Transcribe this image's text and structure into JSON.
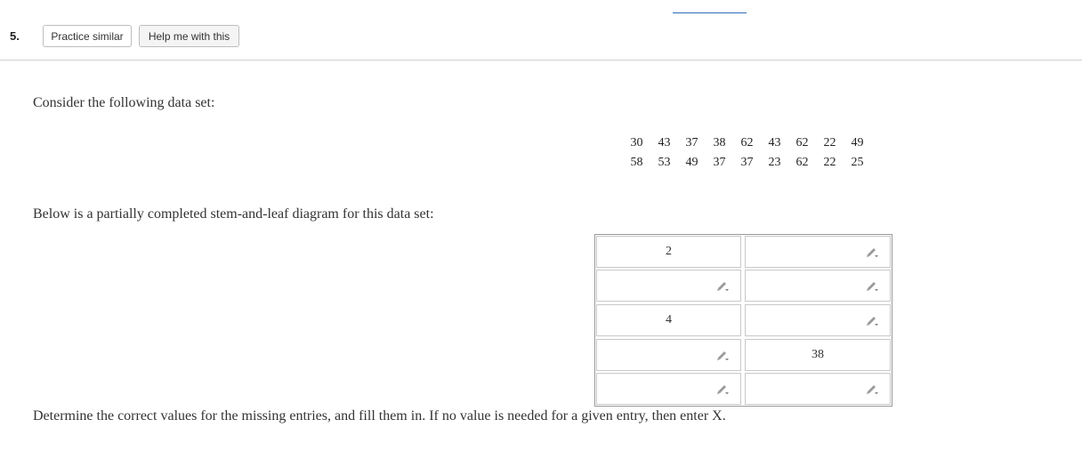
{
  "question": {
    "number": "5.",
    "practice_label": "Practice similar",
    "help_label": "Help me with this"
  },
  "text": {
    "intro": "Consider the following data set:",
    "below": "Below is a partially completed stem-and-leaf diagram for this data set:",
    "instructions": "Determine the correct values for the missing entries, and fill them in. If no value is needed for a given entry, then enter X."
  },
  "dataset": {
    "row1": [
      "30",
      "43",
      "37",
      "38",
      "62",
      "43",
      "62",
      "22",
      "49"
    ],
    "row2": [
      "58",
      "53",
      "49",
      "37",
      "37",
      "23",
      "62",
      "22",
      "25"
    ]
  },
  "stem_leaf": {
    "rows": [
      {
        "stem": "2",
        "leaf": ""
      },
      {
        "stem": "",
        "leaf": ""
      },
      {
        "stem": "4",
        "leaf": ""
      },
      {
        "stem": "",
        "leaf": "38"
      },
      {
        "stem": "",
        "leaf": ""
      }
    ]
  },
  "icons": {
    "edit": "pencil-dropdown-icon",
    "accent": "#2a6ebb"
  }
}
